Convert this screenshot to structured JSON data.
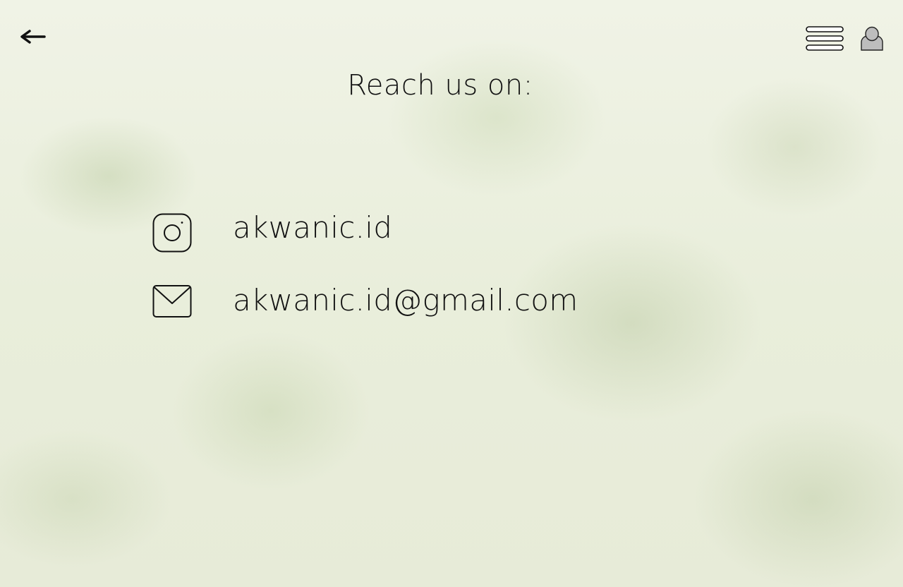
{
  "header": {
    "back_icon": "arrow-left-icon",
    "menu_icon": "hamburger-menu-icon",
    "user_icon": "user-icon"
  },
  "title": "Reach us on:",
  "contacts": [
    {
      "icon": "instagram-icon",
      "label": "akwanic.id"
    },
    {
      "icon": "mail-icon",
      "label": "akwanic.id@gmail.com"
    }
  ],
  "colors": {
    "background": "#eef1e2",
    "text": "#111111",
    "user_icon_fill": "#bdbdbd"
  }
}
